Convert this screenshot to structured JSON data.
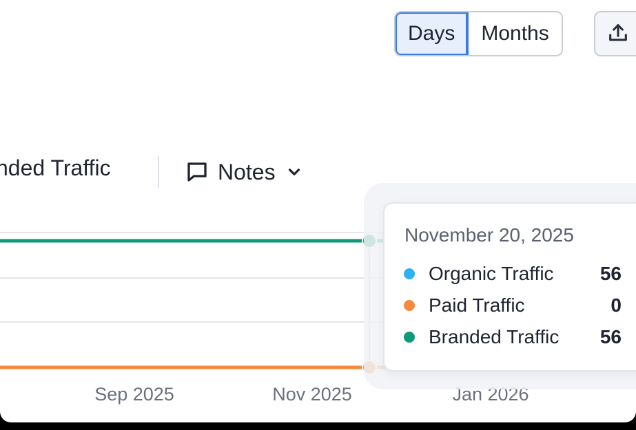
{
  "toolbar": {
    "period_options": [
      "Days",
      "Months"
    ],
    "period_selected": "Days",
    "export_icon": "upload-icon"
  },
  "legend": {
    "partial_label": "nded Traffic",
    "notes_label": "Notes",
    "notes_icon": "comment-icon",
    "notes_chevron": "chevron-down-icon"
  },
  "colors": {
    "organic": "#2db1f5",
    "paid": "#f7893d",
    "branded": "#0e9a76",
    "accent": "#3d7be0"
  },
  "chart_data": {
    "type": "line",
    "x_ticks": [
      "Sep 2025",
      "Nov 2025",
      "Jan 2026"
    ],
    "series": [
      {
        "name": "Organic Traffic",
        "color": "#2db1f5",
        "values": [
          56,
          56,
          56
        ]
      },
      {
        "name": "Paid Traffic",
        "color": "#f7893d",
        "values": [
          0,
          0,
          0
        ]
      },
      {
        "name": "Branded Traffic",
        "color": "#0e9a76",
        "values": [
          56,
          56,
          56
        ]
      }
    ],
    "grid": true,
    "hover_x": "November 20, 2025"
  },
  "tooltip": {
    "date": "November 20, 2025",
    "rows": [
      {
        "label": "Organic Traffic",
        "value": "56"
      },
      {
        "label": "Paid Traffic",
        "value": "0"
      },
      {
        "label": "Branded Traffic",
        "value": "56"
      }
    ]
  }
}
